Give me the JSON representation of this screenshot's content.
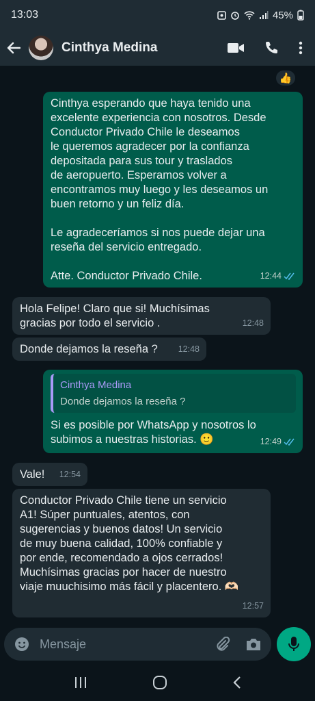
{
  "status": {
    "time": "13:03",
    "battery": "45%"
  },
  "header": {
    "contact_name": "Cinthya Medina"
  },
  "messages": [
    {
      "text": "Cinthya esperando que haya tenido una\nexcelente experiencia con nosotros. Desde\nConductor Privado Chile le deseamos\nle queremos agradecer por la confianza\ndepositada para sus tour y traslados\nde aeropuerto. Esperamos volver a\nencontramos muy luego y les deseamos un\nbuen retorno y un feliz día.\n\nLe agradeceríamos si nos puede dejar una\nreseña del servicio entregado.\n\nAtte. Conductor Privado Chile.",
      "time": "12:44",
      "reaction": "👍"
    },
    {
      "text": "Hola Felipe! Claro que si! Muchísimas\ngracias por todo el servicio .",
      "time": "12:48"
    },
    {
      "text": "Donde dejamos la reseña ?",
      "time": "12:48"
    },
    {
      "quote_name": "Cinthya Medina",
      "quote_text": "Donde dejamos la reseña ?",
      "text": "Si es posible por WhatsApp y nosotros lo\nsubimos a nuestras historias. 🙂",
      "time": "12:49"
    },
    {
      "text": "Vale!",
      "time": "12:54"
    },
    {
      "text": "Conductor Privado Chile tiene un servicio\nA1! Súper puntuales, atentos, con\nsugerencias y buenos datos! Un servicio\nde muy buena calidad, 100% confiable y\npor ende, recomendado a ojos cerrados!\nMuchísimas gracias por hacer de nuestro\nviaje muuchisimo más fácil y placentero. 🫶🏻",
      "time": "12:57"
    }
  ],
  "input": {
    "placeholder": "Mensaje"
  },
  "colors": {
    "outgoing": "#005c4b",
    "incoming": "#202c33",
    "accent": "#00a884",
    "read_ticks": "#53bdeb"
  }
}
